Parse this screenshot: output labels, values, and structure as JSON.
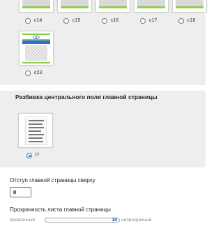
{
  "layout_options_top": {
    "items": [
      {
        "label": "c14",
        "selected": false
      },
      {
        "label": "c15",
        "selected": false
      },
      {
        "label": "c16",
        "selected": false
      },
      {
        "label": "c17",
        "selected": false
      },
      {
        "label": "c18",
        "selected": false
      },
      {
        "label": "c23",
        "selected": false
      }
    ]
  },
  "central_field": {
    "title": "Разбивка центрального поля главной страницы",
    "option": {
      "label": "l7",
      "selected": true
    }
  },
  "offset": {
    "label": "Отступ главной страницы сверху",
    "value": "0"
  },
  "opacity": {
    "label": "Прозрачность листа главной страницы",
    "min_label": "прозрачный",
    "max_label": "непрозрачный",
    "value": "10"
  },
  "colors": {
    "accent_green": "#8fce47",
    "accent_blue": "#2f6fd6",
    "panel_bg": "#eeeeee"
  }
}
